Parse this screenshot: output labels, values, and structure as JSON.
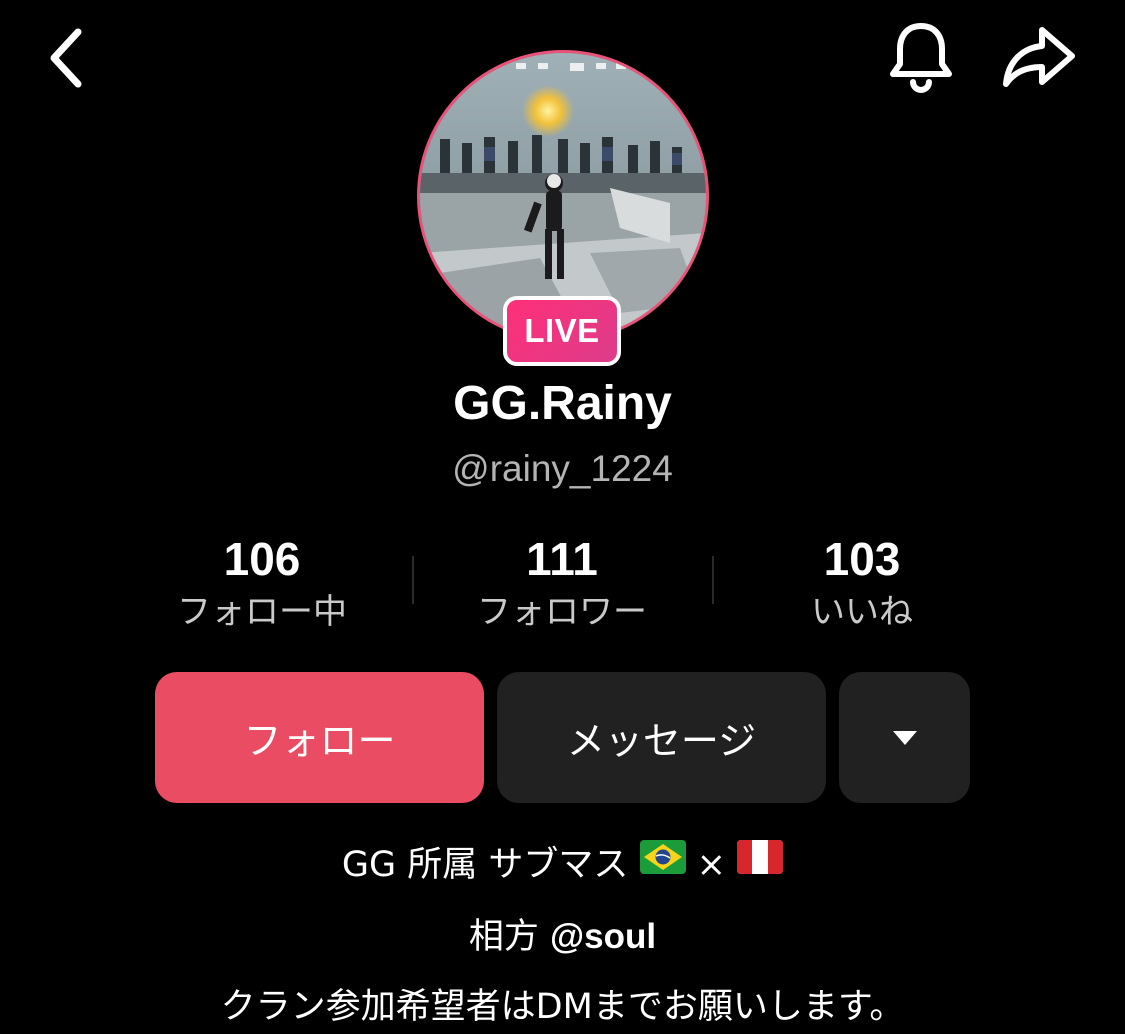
{
  "header": {
    "back_icon": "chevron-left-icon",
    "bell_icon": "bell-icon",
    "share_icon": "share-arrow-icon"
  },
  "profile": {
    "live_label": "LIVE",
    "display_name": "GG.Rainy",
    "handle": "@rainy_1224",
    "ring_color": "#e9537a"
  },
  "stats": [
    {
      "value": "106",
      "label": "フォロー中"
    },
    {
      "value": "111",
      "label": "フォロワー"
    },
    {
      "value": "103",
      "label": "いいね"
    }
  ],
  "actions": {
    "follow_label": "フォロー",
    "message_label": "メッセージ",
    "more_icon": "caret-down-icon",
    "follow_color": "#ea4d63"
  },
  "bio": {
    "line1_text": "GG 所属 サブマス",
    "line1_separator": "×",
    "line1_flags": [
      "flag-brazil-icon",
      "flag-peru-icon"
    ],
    "line2_prefix": "相方",
    "line2_mention": "@soul",
    "line3": "クラン参加希望者はDMまでお願いします。"
  }
}
